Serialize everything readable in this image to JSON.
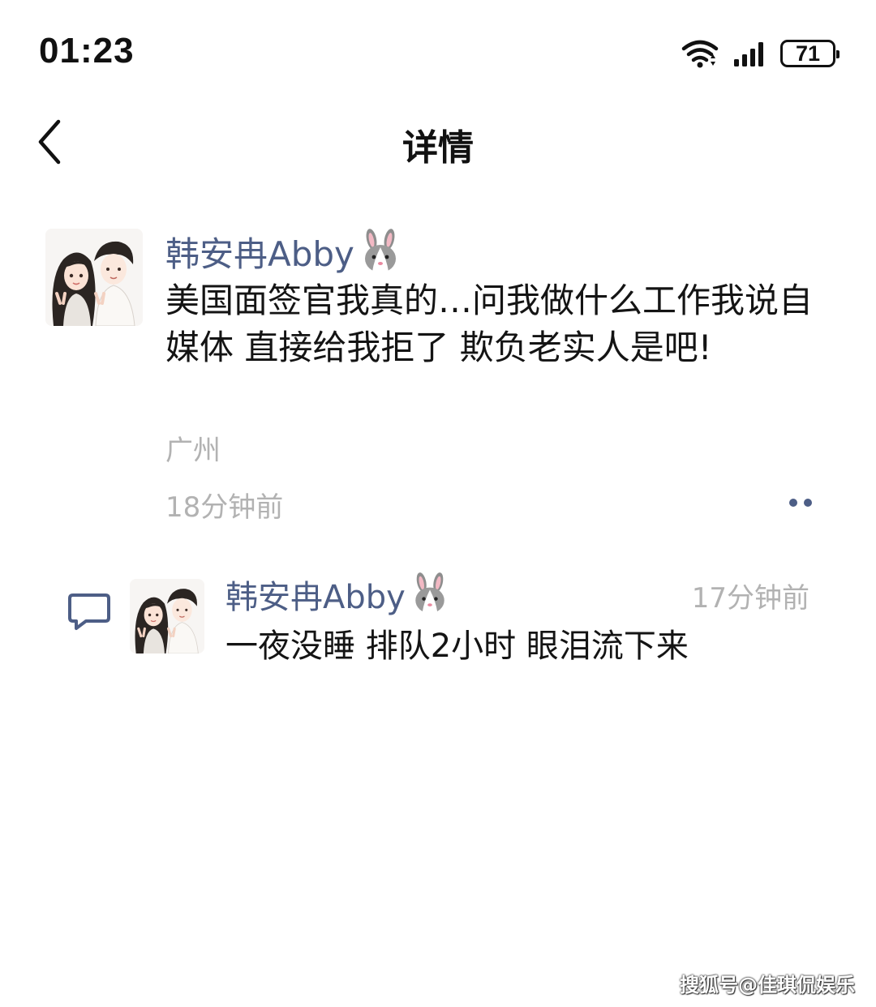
{
  "status_bar": {
    "time": "01:23",
    "battery": "71",
    "wifi_icon": "wifi-icon",
    "signal_icon": "signal-icon"
  },
  "nav": {
    "back_icon": "chevron-left-icon",
    "title": "详情"
  },
  "post": {
    "author": "韩安冉Abby",
    "author_emoji": "rabbit-face-icon",
    "content": "美国面签官我真的…问我做什么工作我说自媒体 直接给我拒了 欺负老实人是吧!",
    "location": "广州",
    "time": "18分钟前",
    "more_icon": "more-dots-icon"
  },
  "reply": {
    "icon": "comment-icon",
    "author": "韩安冉Abby",
    "author_emoji": "rabbit-face-icon",
    "time": "17分钟前",
    "content": "一夜没睡 排队2小时 眼泪流下来"
  },
  "watermark": "搜狐号@佳琪侃娱乐",
  "colors": {
    "author_name": "#4d5e86",
    "meta_text": "#b2b2b2",
    "body_text": "#141414",
    "background": "#ffffff"
  }
}
